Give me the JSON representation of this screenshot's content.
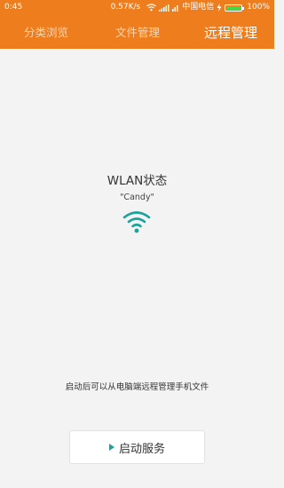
{
  "status_bar": {
    "time": "0:45",
    "speed": "0.57K/s",
    "carrier": "中国电信",
    "battery": "100%"
  },
  "tabs": [
    {
      "label": "分类浏览",
      "active": false
    },
    {
      "label": "文件管理",
      "active": false
    },
    {
      "label": "远程管理",
      "active": true
    }
  ],
  "main": {
    "wlan_title": "WLAN状态",
    "ssid": "\"Candy\"",
    "hint": "启动后可以从电脑端远程管理手机文件",
    "start_button_label": "启动服务"
  },
  "colors": {
    "header": "#ee7d1e",
    "accent": "#1aa39a"
  }
}
